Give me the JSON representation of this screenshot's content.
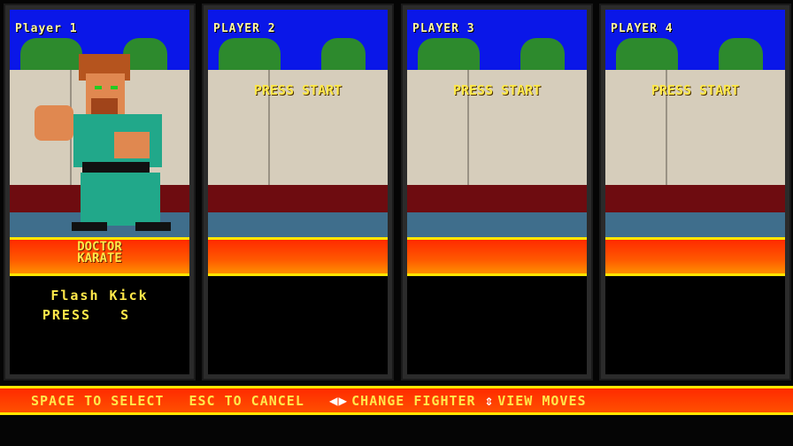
{
  "players": [
    {
      "title": "Player 1",
      "fighter": "DOCTOR\nKARATE",
      "fighter_line1": "DOCTOR",
      "fighter_line2": "KARATE",
      "move_name": "Flash Kick",
      "move_input": "PRESS   S"
    },
    {
      "title": "PLAYER 2",
      "status": "PRESS START"
    },
    {
      "title": "PLAYER 3",
      "status": "PRESS START"
    },
    {
      "title": "PLAYER 4",
      "status": "PRESS START"
    }
  ],
  "controls": {
    "select": "SPACE TO SELECT",
    "cancel": "ESC TO CANCEL",
    "change": "CHANGE FIGHTER",
    "view": "VIEW MOVES",
    "change_icon": "left-right-arrows-icon",
    "view_icon": "up-down-arrows-icon"
  },
  "colors": {
    "sky": "#0a17e8",
    "band": "#ff3a00",
    "text": "#ffe84a"
  }
}
